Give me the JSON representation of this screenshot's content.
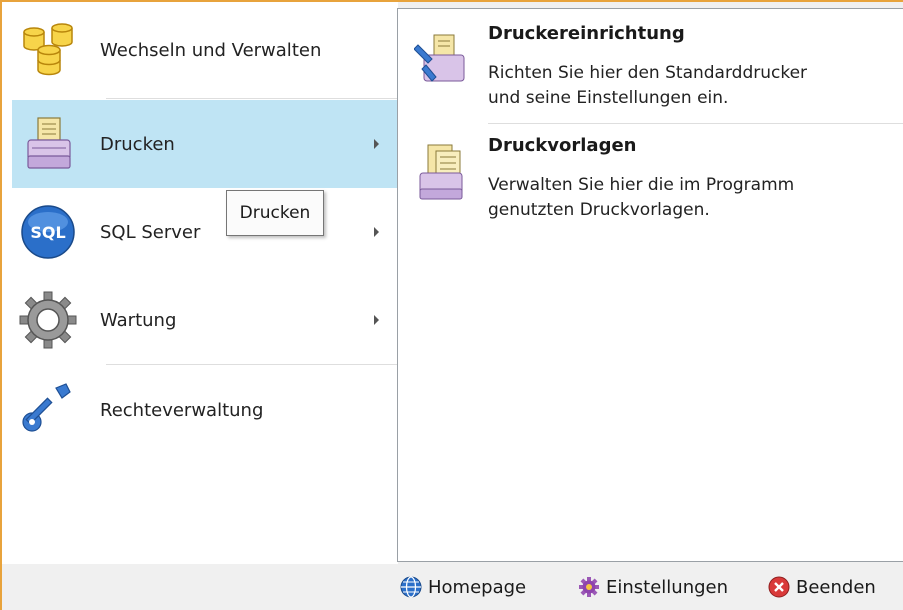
{
  "menu": {
    "items": [
      {
        "label": "Wechseln und Verwalten",
        "icon": "database-icon",
        "has_submenu": false,
        "active": false
      },
      {
        "label": "Drucken",
        "icon": "printer-icon",
        "has_submenu": true,
        "active": true
      },
      {
        "label": "SQL Server",
        "icon": "sql-icon",
        "has_submenu": true,
        "active": false
      },
      {
        "label": "Wartung",
        "icon": "gear-icon",
        "has_submenu": true,
        "active": false
      },
      {
        "label": "Rechteverwaltung",
        "icon": "key-icon",
        "has_submenu": false,
        "active": false
      }
    ],
    "tooltip": "Drucken"
  },
  "submenu": {
    "items": [
      {
        "title": "Druckereinrichtung",
        "desc_line1": "Richten Sie hier den Standarddrucker",
        "desc_line2": "und seine Einstellungen ein.",
        "icon": "printer-setup-icon"
      },
      {
        "title": "Druckvorlagen",
        "desc_line1": "Verwalten Sie hier die im Programm",
        "desc_line2": "genutzten Druckvorlagen.",
        "icon": "print-templates-icon"
      }
    ]
  },
  "footer": {
    "homepage": "Homepage",
    "settings": "Einstellungen",
    "exit": "Beenden"
  },
  "colors": {
    "accent_border": "#e8a33c",
    "active_item_bg": "#bfe4f4"
  }
}
